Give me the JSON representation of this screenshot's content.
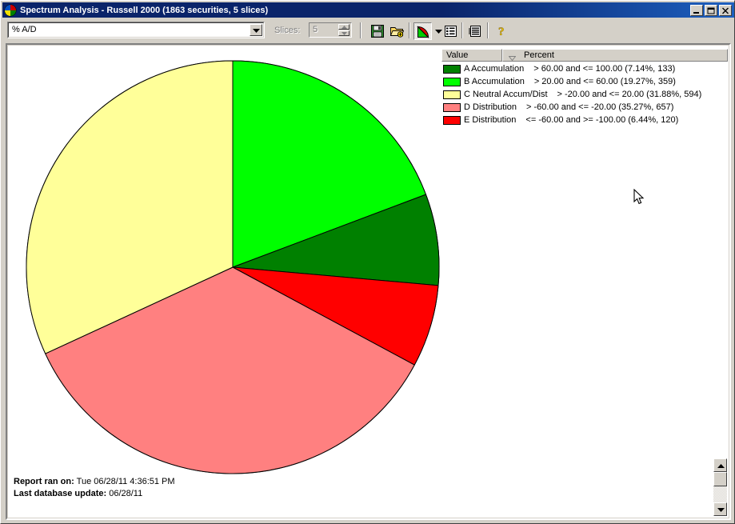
{
  "window": {
    "title": "Spectrum Analysis - Russell 2000 (1863 securities, 5 slices)",
    "icon": "pie-chart-icon",
    "minimize_label": "_",
    "maximize_label": "□",
    "close_label": "✕"
  },
  "toolbar": {
    "metric_combo": {
      "value": "% A/D",
      "placeholder": "% A/D",
      "arrow_icon": "chevron-down-icon"
    },
    "slices_label": "Slices:",
    "slices_value": "5",
    "spin_up_icon": "spin-up-icon",
    "spin_down_icon": "spin-down-icon",
    "buttons": [
      {
        "name": "save-button",
        "icon": "floppy-disk-icon",
        "tooltip": "Save"
      },
      {
        "name": "open-button",
        "icon": "open-folder-icon",
        "tooltip": "Open"
      },
      {
        "name": "pie-chart-view-button",
        "icon": "pie-chart-icon",
        "tooltip": "Chart View"
      },
      {
        "name": "chart-type-dropdown",
        "icon": "chevron-down-icon",
        "tooltip": "Chart Type"
      },
      {
        "name": "list-view-button",
        "icon": "list-view-icon",
        "tooltip": "List View"
      },
      {
        "name": "report-view-button",
        "icon": "report-view-icon",
        "tooltip": "Report View"
      },
      {
        "name": "help-button",
        "icon": "question-mark-icon",
        "tooltip": "Help"
      }
    ]
  },
  "legend": {
    "columns": [
      "Value",
      "Percent"
    ],
    "sort_indicator": "sort-descending-icon",
    "rows": [
      {
        "letter": "A",
        "name": "A Accumulation",
        "range": "> 60.00 and <= 100.00 (7.14%, 133)",
        "color": "#008000",
        "percent": 7.14,
        "count": 133
      },
      {
        "letter": "B",
        "name": "B Accumulation",
        "range": "> 20.00 and <= 60.00 (19.27%, 359)",
        "color": "#00ff00",
        "percent": 19.27,
        "count": 359
      },
      {
        "letter": "C",
        "name": "C Neutral Accum/Dist",
        "range": "> -20.00 and <= 20.00 (31.88%, 594)",
        "color": "#ffff99",
        "percent": 31.88,
        "count": 594
      },
      {
        "letter": "D",
        "name": "D Distribution",
        "range": "> -60.00 and <= -20.00 (35.27%, 657)",
        "color": "#ff8080",
        "percent": 35.27,
        "count": 657
      },
      {
        "letter": "E",
        "name": "E Distribution",
        "range": "<= -60.00 and >= -100.00 (6.44%, 120)",
        "color": "#ff0000",
        "percent": 6.44,
        "count": 120
      }
    ]
  },
  "footer": {
    "report_ran_label": "Report ran on:",
    "report_ran_value": "Tue 06/28/11 4:36:51 PM",
    "last_update_label": "Last database update:",
    "last_update_value": "06/28/11"
  },
  "scrollbar": {
    "up_icon": "scroll-up-icon",
    "down_icon": "scroll-down-icon"
  },
  "chart_data": {
    "type": "pie",
    "title": "Spectrum Analysis - Russell 2000",
    "total_securities": 1863,
    "slices": 5,
    "start_angle_deg": 0,
    "direction": "clockwise",
    "center": [
      265,
      265
    ],
    "radius": 258,
    "stroke": "#000000",
    "categories": [
      "B Accumulation",
      "A Accumulation",
      "E Distribution",
      "D Distribution",
      "C Neutral Accum/Dist"
    ],
    "values": [
      19.27,
      7.14,
      6.44,
      35.27,
      31.88
    ],
    "counts": [
      359,
      133,
      120,
      657,
      594
    ],
    "colors": [
      "#00ff00",
      "#008000",
      "#ff0000",
      "#ff8080",
      "#ffff99"
    ],
    "legend_position": "top-right",
    "xlabel": "",
    "ylabel": ""
  }
}
